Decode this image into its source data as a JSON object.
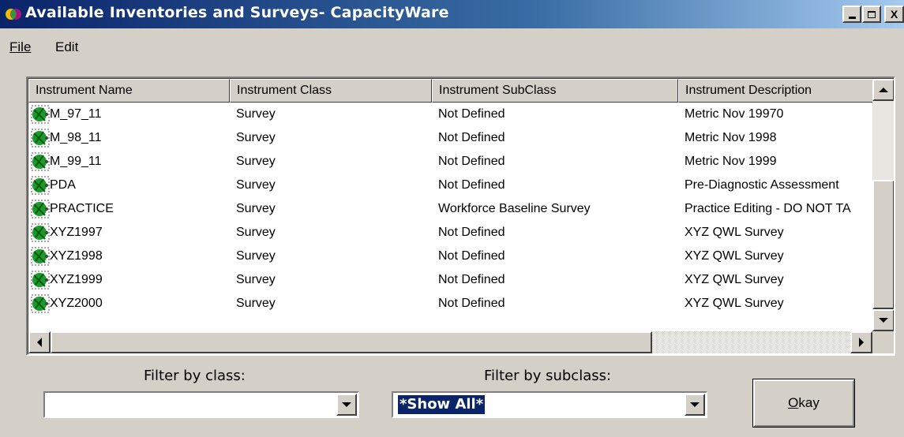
{
  "window": {
    "title": "Available Inventories and Surveys- CapacityWare",
    "icon": "app-logo-icon",
    "controls": [
      "minimize-icon",
      "maximize-icon",
      "close-icon"
    ],
    "close_label": "X"
  },
  "menu": {
    "file": "File",
    "edit": "Edit"
  },
  "grid": {
    "columns": [
      "Instrument Name",
      "Instrument Class",
      "Instrument SubClass",
      "Instrument Description"
    ],
    "rows": [
      {
        "name": "M_97_11",
        "class": "Survey",
        "subclass": "Not Defined",
        "description": "Metric Nov 19970"
      },
      {
        "name": "M_98_11",
        "class": "Survey",
        "subclass": "Not Defined",
        "description": "Metric Nov 1998"
      },
      {
        "name": "M_99_11",
        "class": "Survey",
        "subclass": "Not Defined",
        "description": "Metric Nov 1999"
      },
      {
        "name": "PDA",
        "class": "Survey",
        "subclass": "Not Defined",
        "description": "Pre-Diagnostic Assessment"
      },
      {
        "name": "PRACTICE",
        "class": "Survey",
        "subclass": "Workforce Baseline Survey",
        "description": "Practice Editing - DO NOT TA"
      },
      {
        "name": "XYZ1997",
        "class": "Survey",
        "subclass": "Not Defined",
        "description": "XYZ QWL Survey"
      },
      {
        "name": "XYZ1998",
        "class": "Survey",
        "subclass": "Not Defined",
        "description": "XYZ QWL Survey"
      },
      {
        "name": "XYZ1999",
        "class": "Survey",
        "subclass": "Not Defined",
        "description": "XYZ QWL Survey"
      },
      {
        "name": "XYZ2000",
        "class": "Survey",
        "subclass": "Not Defined",
        "description": "XYZ QWL Survey"
      }
    ],
    "row_icon": "survey-instrument-icon"
  },
  "filters": {
    "class_label": "Filter by class:",
    "class_value": "",
    "subclass_label": "Filter by subclass:",
    "subclass_value": "*Show All*"
  },
  "buttons": {
    "okay": "Okay"
  },
  "colors": {
    "titlebar_start": "#0a246a",
    "titlebar_end": "#a6caf0",
    "window_bg": "#d4d0c8",
    "selection": "#0a246a"
  }
}
